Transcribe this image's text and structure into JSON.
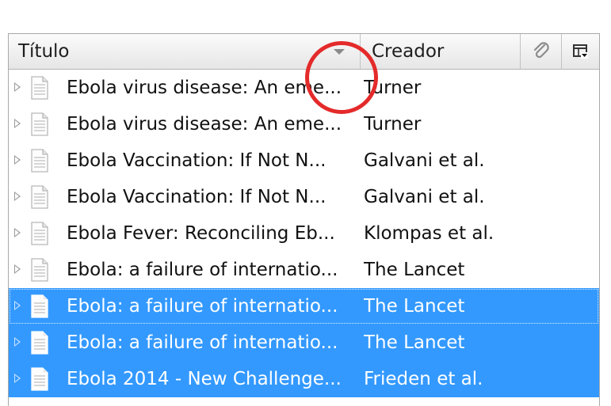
{
  "header": {
    "title_label": "Título",
    "creator_label": "Creador",
    "attachments_icon": "paperclip-icon",
    "column_picker_icon": "column-picker-icon",
    "sort_icon": "sort-dropdown-arrow-icon"
  },
  "rows": [
    {
      "title": "Ebola virus disease: An eme...",
      "creator": "Turner",
      "selected": false
    },
    {
      "title": "Ebola virus disease: An eme...",
      "creator": "Turner",
      "selected": false
    },
    {
      "title": "Ebola Vaccination: If Not N...",
      "creator": "Galvani et al.",
      "selected": false
    },
    {
      "title": "Ebola Vaccination: If Not N...",
      "creator": "Galvani et al.",
      "selected": false
    },
    {
      "title": "Ebola Fever: Reconciling Eb...",
      "creator": "Klompas et al.",
      "selected": false
    },
    {
      "title": "Ebola: a failure of internatio...",
      "creator": "The Lancet",
      "selected": false
    },
    {
      "title": "Ebola: a failure of internatio...",
      "creator": "The Lancet",
      "selected": true
    },
    {
      "title": "Ebola: a failure of internatio...",
      "creator": "The Lancet",
      "selected": true
    },
    {
      "title": "Ebola 2014 - New Challenge...",
      "creator": "Frieden et al.",
      "selected": true
    }
  ],
  "colors": {
    "selection": "#3399ff",
    "highlight_circle": "#e42a2a"
  }
}
